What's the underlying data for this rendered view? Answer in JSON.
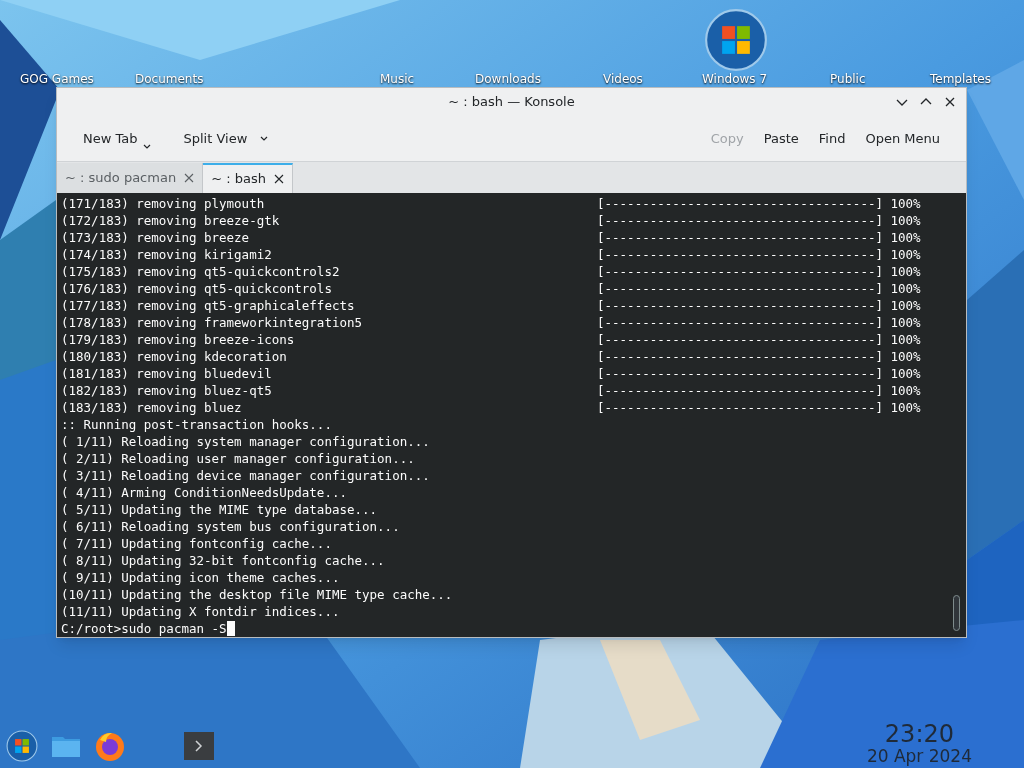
{
  "desktop_icons": [
    {
      "label": "GOG Games"
    },
    {
      "label": "Documents"
    },
    {
      "label": "Music"
    },
    {
      "label": "Downloads"
    },
    {
      "label": "Videos"
    },
    {
      "label": "Windows 7",
      "kind": "logo"
    },
    {
      "label": "Public"
    },
    {
      "label": "Templates"
    }
  ],
  "window": {
    "title": "~ : bash — Konsole"
  },
  "toolbar": {
    "left": [
      {
        "label": "New Tab",
        "menu": true,
        "disabled": false
      },
      {
        "label": "Split View",
        "menu": true,
        "disabled": false
      }
    ],
    "right": [
      {
        "label": "Copy",
        "disabled": true
      },
      {
        "label": "Paste",
        "disabled": false
      },
      {
        "label": "Find",
        "disabled": false
      },
      {
        "label": "Open Menu",
        "disabled": false
      }
    ]
  },
  "tabs": [
    {
      "label": "~ : sudo pacman",
      "selected": false
    },
    {
      "label": "~ : bash",
      "selected": true
    }
  ],
  "terminal": {
    "lines": [
      {
        "text": "(171/183) removing plymouth",
        "progress": "[------------------------------------] 100%"
      },
      {
        "text": "(172/183) removing breeze-gtk",
        "progress": "[------------------------------------] 100%"
      },
      {
        "text": "(173/183) removing breeze",
        "progress": "[------------------------------------] 100%"
      },
      {
        "text": "(174/183) removing kirigami2",
        "progress": "[------------------------------------] 100%"
      },
      {
        "text": "(175/183) removing qt5-quickcontrols2",
        "progress": "[------------------------------------] 100%"
      },
      {
        "text": "(176/183) removing qt5-quickcontrols",
        "progress": "[------------------------------------] 100%"
      },
      {
        "text": "(177/183) removing qt5-graphicaleffects",
        "progress": "[------------------------------------] 100%"
      },
      {
        "text": "(178/183) removing frameworkintegration5",
        "progress": "[------------------------------------] 100%"
      },
      {
        "text": "(179/183) removing breeze-icons",
        "progress": "[------------------------------------] 100%"
      },
      {
        "text": "(180/183) removing kdecoration",
        "progress": "[------------------------------------] 100%"
      },
      {
        "text": "(181/183) removing bluedevil",
        "progress": "[------------------------------------] 100%"
      },
      {
        "text": "(182/183) removing bluez-qt5",
        "progress": "[------------------------------------] 100%"
      },
      {
        "text": "(183/183) removing bluez",
        "progress": "[------------------------------------] 100%"
      },
      {
        "text": ":: Running post-transaction hooks..."
      },
      {
        "text": "( 1/11) Reloading system manager configuration..."
      },
      {
        "text": "( 2/11) Reloading user manager configuration..."
      },
      {
        "text": "( 3/11) Reloading device manager configuration..."
      },
      {
        "text": "( 4/11) Arming ConditionNeedsUpdate..."
      },
      {
        "text": "( 5/11) Updating the MIME type database..."
      },
      {
        "text": "( 6/11) Reloading system bus configuration..."
      },
      {
        "text": "( 7/11) Updating fontconfig cache..."
      },
      {
        "text": "( 8/11) Updating 32-bit fontconfig cache..."
      },
      {
        "text": "( 9/11) Updating icon theme caches..."
      },
      {
        "text": "(10/11) Updating the desktop file MIME type cache..."
      },
      {
        "text": "(11/11) Updating X fontdir indices..."
      }
    ],
    "prompt": "C:/root>",
    "input": "sudo pacman -S"
  },
  "taskbar": {
    "items": [
      {
        "kind": "start"
      },
      {
        "kind": "files"
      },
      {
        "kind": "browser"
      },
      {
        "kind": "terminal"
      }
    ]
  },
  "clock": {
    "time": "23:20",
    "date": "20 Apr 2024"
  }
}
